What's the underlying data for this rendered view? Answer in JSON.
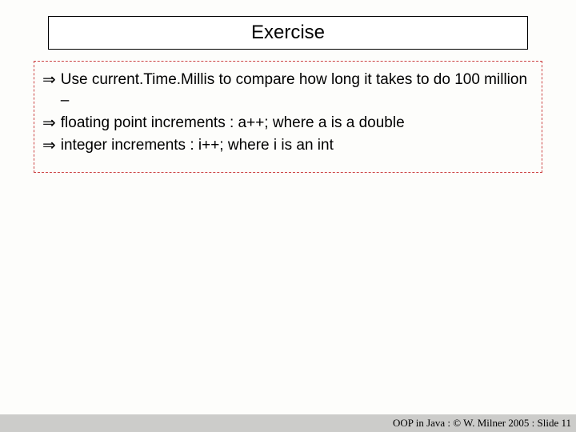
{
  "title": "Exercise",
  "bullets": [
    "Use current.Time.Millis to compare how long it takes to do 100 million –",
    "floating point increments : a++; where a is a double",
    "integer increments : i++; where i is an int"
  ],
  "footer": "OOP in Java : © W. Milner 2005 : Slide 11"
}
